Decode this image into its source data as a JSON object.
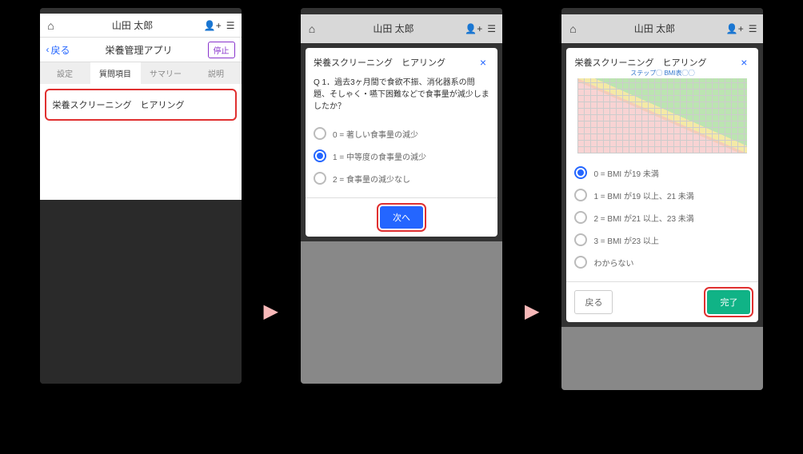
{
  "common": {
    "user_name": "山田 太郎"
  },
  "screen1": {
    "back_label": "戻る",
    "nav_title": "栄養管理アプリ",
    "stop_label": "停止",
    "tabs": [
      "設定",
      "質問項目",
      "サマリー",
      "説明"
    ],
    "list_item": "栄養スクリーニング　ヒアリング"
  },
  "screen2": {
    "modal_title": "栄養スクリーニング　ヒアリング",
    "question": "Q 1．過去3ヶ月間で食欲不振、消化器系の問題、そしゃく・嚥下困難などで食事量が減少しましたか？",
    "options": [
      "0 = 著しい食事量の減少",
      "1 = 中等度の食事量の減少",
      "2 = 食事量の減少なし"
    ],
    "selected_index": 1,
    "next_label": "次へ"
  },
  "screen3": {
    "modal_title": "栄養スクリーニング　ヒアリング",
    "chart_title": "ステップ◯ BMI表◯◯",
    "options": [
      "0 = BMI が19 未満",
      "1 = BMI が19 以上、21 未満",
      "2 = BMI が21 以上、23 未満",
      "3 = BMI が23 以上",
      "わからない"
    ],
    "selected_index": 0,
    "back_label": "戻る",
    "done_label": "完了"
  }
}
